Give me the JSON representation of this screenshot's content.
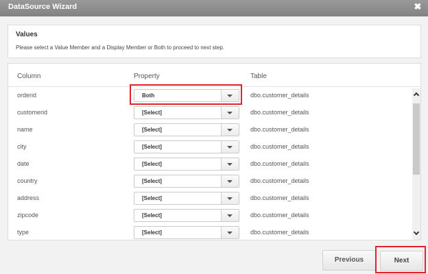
{
  "window": {
    "title": "DataSource Wizard",
    "close_glyph": "✖"
  },
  "info": {
    "heading": "Values",
    "description": "Please select a Value Member and a Display Member or Both to proceed to next step."
  },
  "grid": {
    "headers": {
      "column": "Column",
      "property": "Property",
      "table": "Table"
    },
    "rows": [
      {
        "column": "orderid",
        "property": "Both",
        "table": "dbo.customer_details"
      },
      {
        "column": "customerid",
        "property": "[Select]",
        "table": "dbo.customer_details"
      },
      {
        "column": "name",
        "property": "[Select]",
        "table": "dbo.customer_details"
      },
      {
        "column": "city",
        "property": "[Select]",
        "table": "dbo.customer_details"
      },
      {
        "column": "date",
        "property": "[Select]",
        "table": "dbo.customer_details"
      },
      {
        "column": "country",
        "property": "[Select]",
        "table": "dbo.customer_details"
      },
      {
        "column": "address",
        "property": "[Select]",
        "table": "dbo.customer_details"
      },
      {
        "column": "zipcode",
        "property": "[Select]",
        "table": "dbo.customer_details"
      },
      {
        "column": "type",
        "property": "[Select]",
        "table": "dbo.customer_details"
      }
    ]
  },
  "footer": {
    "previous_label": "Previous",
    "next_label": "Next"
  },
  "colors": {
    "highlight": "#e0202a",
    "titlebar": "#8c8c8c"
  }
}
